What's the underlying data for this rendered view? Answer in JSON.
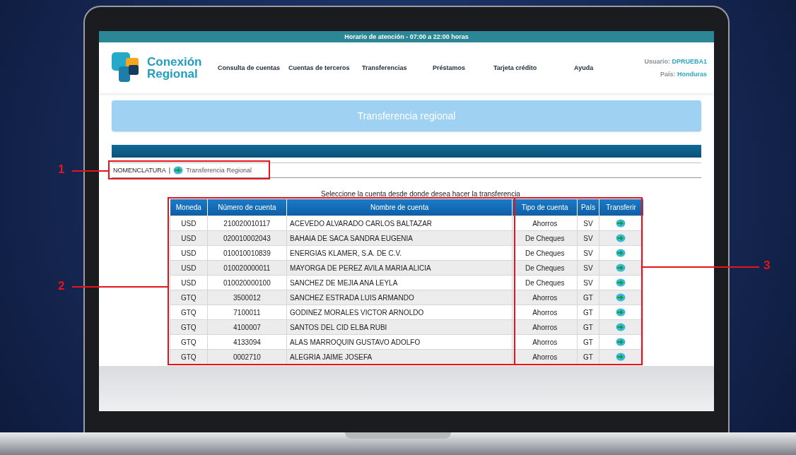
{
  "top_bar": {
    "text": "Horario de atención - 07:00 a 22:00 horas"
  },
  "logo": {
    "line1": "Conexión",
    "line2": "Regional"
  },
  "nav": [
    "Consulta de cuentas",
    "Cuentas de terceros",
    "Transferencias",
    "Préstamos",
    "Tarjeta crédito",
    "Ayuda"
  ],
  "user": {
    "user_label": "Usuario:",
    "user_value": "DPRUEBA1",
    "country_label": "País:",
    "country_value": "Honduras"
  },
  "banner": {
    "title": "Transferencia regional"
  },
  "breadcrumb": {
    "root": "NOMENCLATURA",
    "separator": "|",
    "current": "Transferencia Regional"
  },
  "instruction": "Seleccione la cuenta desde donde desea hacer la transferencia",
  "table": {
    "columns": [
      "Moneda",
      "Número de cuenta",
      "Nombre de cuenta",
      "Tipo de cuenta",
      "País",
      "Transferir"
    ],
    "rows": [
      {
        "currency": "USD",
        "number": "210020010117",
        "name": "ACEVEDO ALVARADO CARLOS BALTAZAR",
        "type": "Ahorros",
        "country": "SV"
      },
      {
        "currency": "USD",
        "number": "020010002043",
        "name": "BAHAIA DE SACA SANDRA EUGENIA",
        "type": "De Cheques",
        "country": "SV"
      },
      {
        "currency": "USD",
        "number": "010010010839",
        "name": "ENERGIAS KLAMER, S.A. DE C.V.",
        "type": "De Cheques",
        "country": "SV"
      },
      {
        "currency": "USD",
        "number": "010020000011",
        "name": "MAYORGA DE PEREZ AVILA MARIA ALICIA",
        "type": "De Cheques",
        "country": "SV"
      },
      {
        "currency": "USD",
        "number": "010020000100",
        "name": "SANCHEZ DE MEJIA ANA LEYLA",
        "type": "De Cheques",
        "country": "SV"
      },
      {
        "currency": "GTQ",
        "number": "3500012",
        "name": "SANCHEZ ESTRADA LUIS ARMANDO",
        "type": "Ahorros",
        "country": "GT"
      },
      {
        "currency": "GTQ",
        "number": "7100011",
        "name": "GODINEZ MORALES VICTOR ARNOLDO",
        "type": "Ahorros",
        "country": "GT"
      },
      {
        "currency": "GTQ",
        "number": "4100007",
        "name": "SANTOS DEL CID ELBA RUBI",
        "type": "Ahorros",
        "country": "GT"
      },
      {
        "currency": "GTQ",
        "number": "4133094",
        "name": "ALAS MARROQUIN GUSTAVO ADOLFO",
        "type": "Ahorros",
        "country": "GT"
      },
      {
        "currency": "GTQ",
        "number": "0002710",
        "name": "ALEGRIA JAIME JOSEFA",
        "type": "Ahorros",
        "country": "GT"
      }
    ]
  },
  "callouts": [
    {
      "label": "1"
    },
    {
      "label": "2"
    },
    {
      "label": "3"
    }
  ]
}
